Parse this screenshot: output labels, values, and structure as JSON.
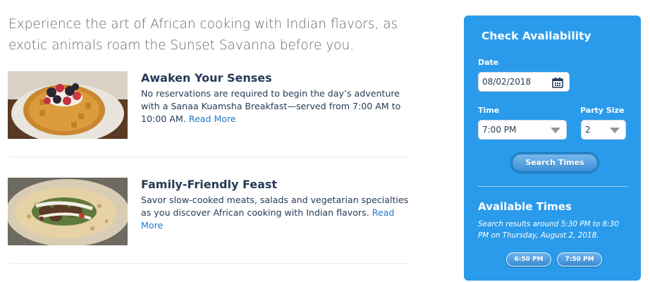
{
  "intro": {
    "text": "Experience the art of African cooking with Indian flavors, as exotic animals roam the Sunset Savanna before you."
  },
  "features": [
    {
      "image_icon": "waffle-photo",
      "title": "Awaken Your Senses",
      "description": "No reservations are required to begin the day’s adventure with a Sanaa Kuamsha Breakfast—served from 7:00 AM to 10:00 AM.",
      "link_label": "Read More"
    },
    {
      "image_icon": "flatbread-photo",
      "title": "Family-Friendly Feast",
      "description": "Savor slow-cooked meats, salads and vegetarian specialties as you discover African cooking with Indian flavors.",
      "link_label": "Read More"
    }
  ],
  "availability": {
    "title": "Check Availability",
    "date_label": "Date",
    "date_value": "08/02/2018",
    "time_label": "Time",
    "time_value": "7:00 PM",
    "party_label": "Party Size",
    "party_value": "2",
    "search_button": "Search Times",
    "available_title": "Available Times",
    "results_text": "Search results around 5:30 PM to 8:30 PM on Thursday, August 2, 2018.",
    "times": [
      "6:50 PM",
      "7:50 PM"
    ],
    "panel_color": "#2a9bea"
  }
}
